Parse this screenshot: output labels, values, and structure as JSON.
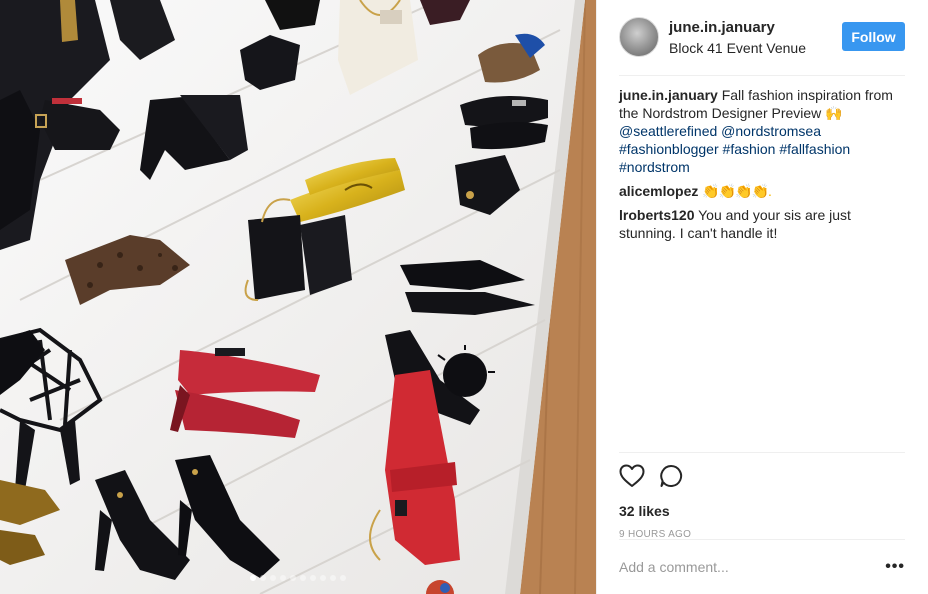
{
  "header": {
    "username": "june.in.january",
    "location": "Block 41 Event Venue",
    "follow_label": "Follow"
  },
  "caption": {
    "username": "june.in.january",
    "text": "Fall fashion inspiration from the Nordstrom Designer Preview",
    "emoji": "🙌",
    "tags": [
      "@seattlerefined",
      "@nordstromsea",
      "#fashionblogger",
      "#fashion",
      "#fallfashion",
      "#nordstrom"
    ]
  },
  "comments": [
    {
      "username": "alicemlopez",
      "text": "👏👏👏👏.",
      "emoji_colored": true
    },
    {
      "username": "lroberts120",
      "text": "You and your sis are just stunning. I can't handle it!"
    }
  ],
  "actions": {
    "like_icon": "heart-icon",
    "comment_icon": "comment-icon",
    "likes": "32 likes",
    "timestamp": "9 HOURS AGO"
  },
  "add_comment": {
    "placeholder": "Add a comment...",
    "more_label": "•••"
  },
  "carousel": {
    "count": 10,
    "active_index": 0
  },
  "colors": {
    "accent": "#3897f0",
    "hashtag": "#003569",
    "muted": "#999999",
    "text": "#262626"
  }
}
